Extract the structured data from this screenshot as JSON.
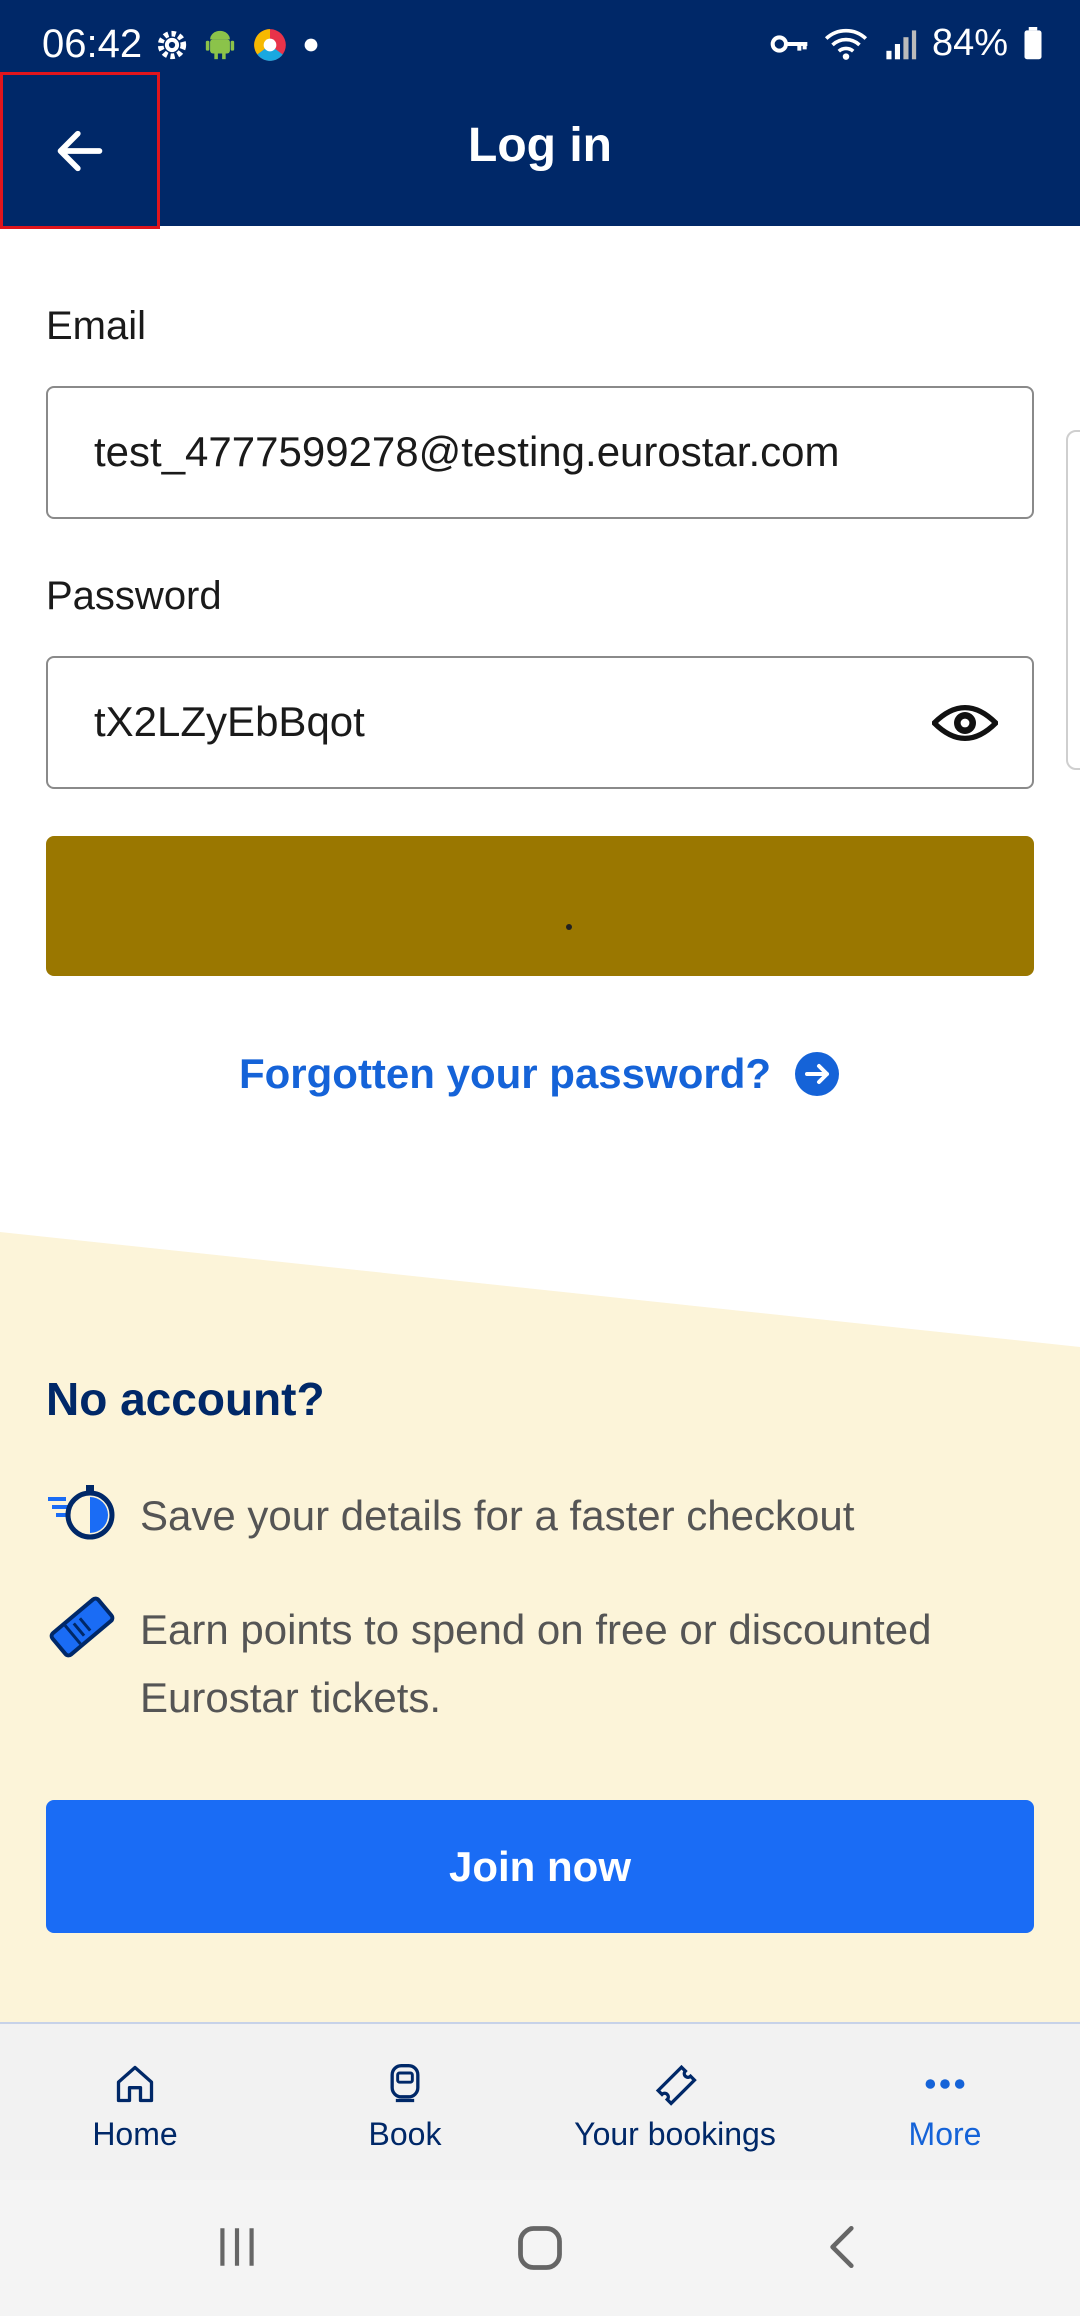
{
  "status_bar": {
    "time": "06:42",
    "battery": "84%",
    "left_icons": [
      "gear-icon",
      "android-icon",
      "browser-icon",
      "dot-icon"
    ],
    "right_icons": [
      "key-icon",
      "wifi-icon",
      "signal-icon",
      "battery-icon"
    ]
  },
  "header": {
    "title": "Log in",
    "back_icon": "arrow-left-icon",
    "background": "#002868"
  },
  "form": {
    "email_label": "Email",
    "email_value": "test_4777599278@testing.eurostar.com",
    "password_label": "Password",
    "password_value": "tX2LZyEbBqot",
    "password_toggle_icon": "eye-icon",
    "submit_button_color": "#9a7700",
    "forgot_link": "Forgotten your password?",
    "forgot_icon": "arrow-right-circle-icon"
  },
  "join": {
    "heading": "No account?",
    "benefits": [
      {
        "icon": "stopwatch-icon",
        "text": "Save your details for a faster checkout"
      },
      {
        "icon": "ticket-icon",
        "text": "Earn points to spend on free or discounted Eurostar tickets."
      }
    ],
    "button": "Join now",
    "background": "#fcf4d9",
    "button_color": "#1a6cf5"
  },
  "bottom_nav": {
    "items": [
      {
        "label": "Home",
        "icon": "home-icon"
      },
      {
        "label": "Book",
        "icon": "train-icon"
      },
      {
        "label": "Your bookings",
        "icon": "ticket-outline-icon"
      },
      {
        "label": "More",
        "icon": "more-dots-icon"
      }
    ]
  },
  "system_nav": [
    "recents-icon",
    "home-square-icon",
    "back-chevron-icon"
  ]
}
